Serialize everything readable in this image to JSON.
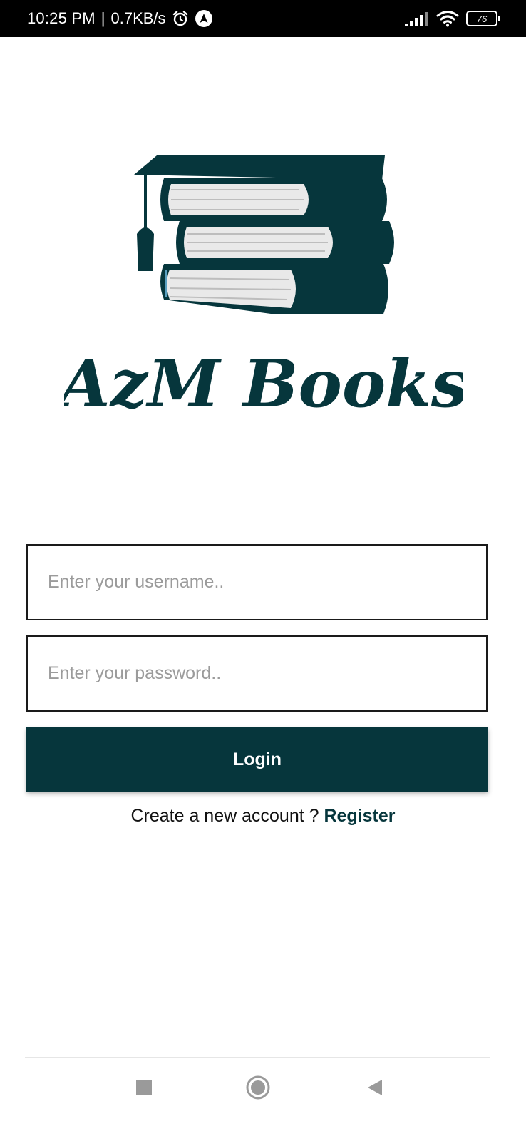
{
  "status_bar": {
    "time": "10:25 PM",
    "separator": "|",
    "network_speed": "0.7KB/s",
    "battery_level": "76",
    "icons": [
      "alarm-icon",
      "navigation-app-icon",
      "signal-icon",
      "wifi-icon",
      "battery-icon"
    ]
  },
  "logo": {
    "brand_name": "AzM Books",
    "color": "#06363c"
  },
  "login_form": {
    "username_placeholder": "Enter your username..",
    "password_placeholder": "Enter your password..",
    "login_label": "Login",
    "register_prompt": "Create a new account ? ",
    "register_label": "Register"
  },
  "nav_bar": {
    "icons": [
      "recents-square-icon",
      "home-circle-icon",
      "back-triangle-icon"
    ]
  },
  "colors": {
    "accent": "#06363c",
    "background": "#ffffff",
    "placeholder": "#9b9b9b"
  }
}
